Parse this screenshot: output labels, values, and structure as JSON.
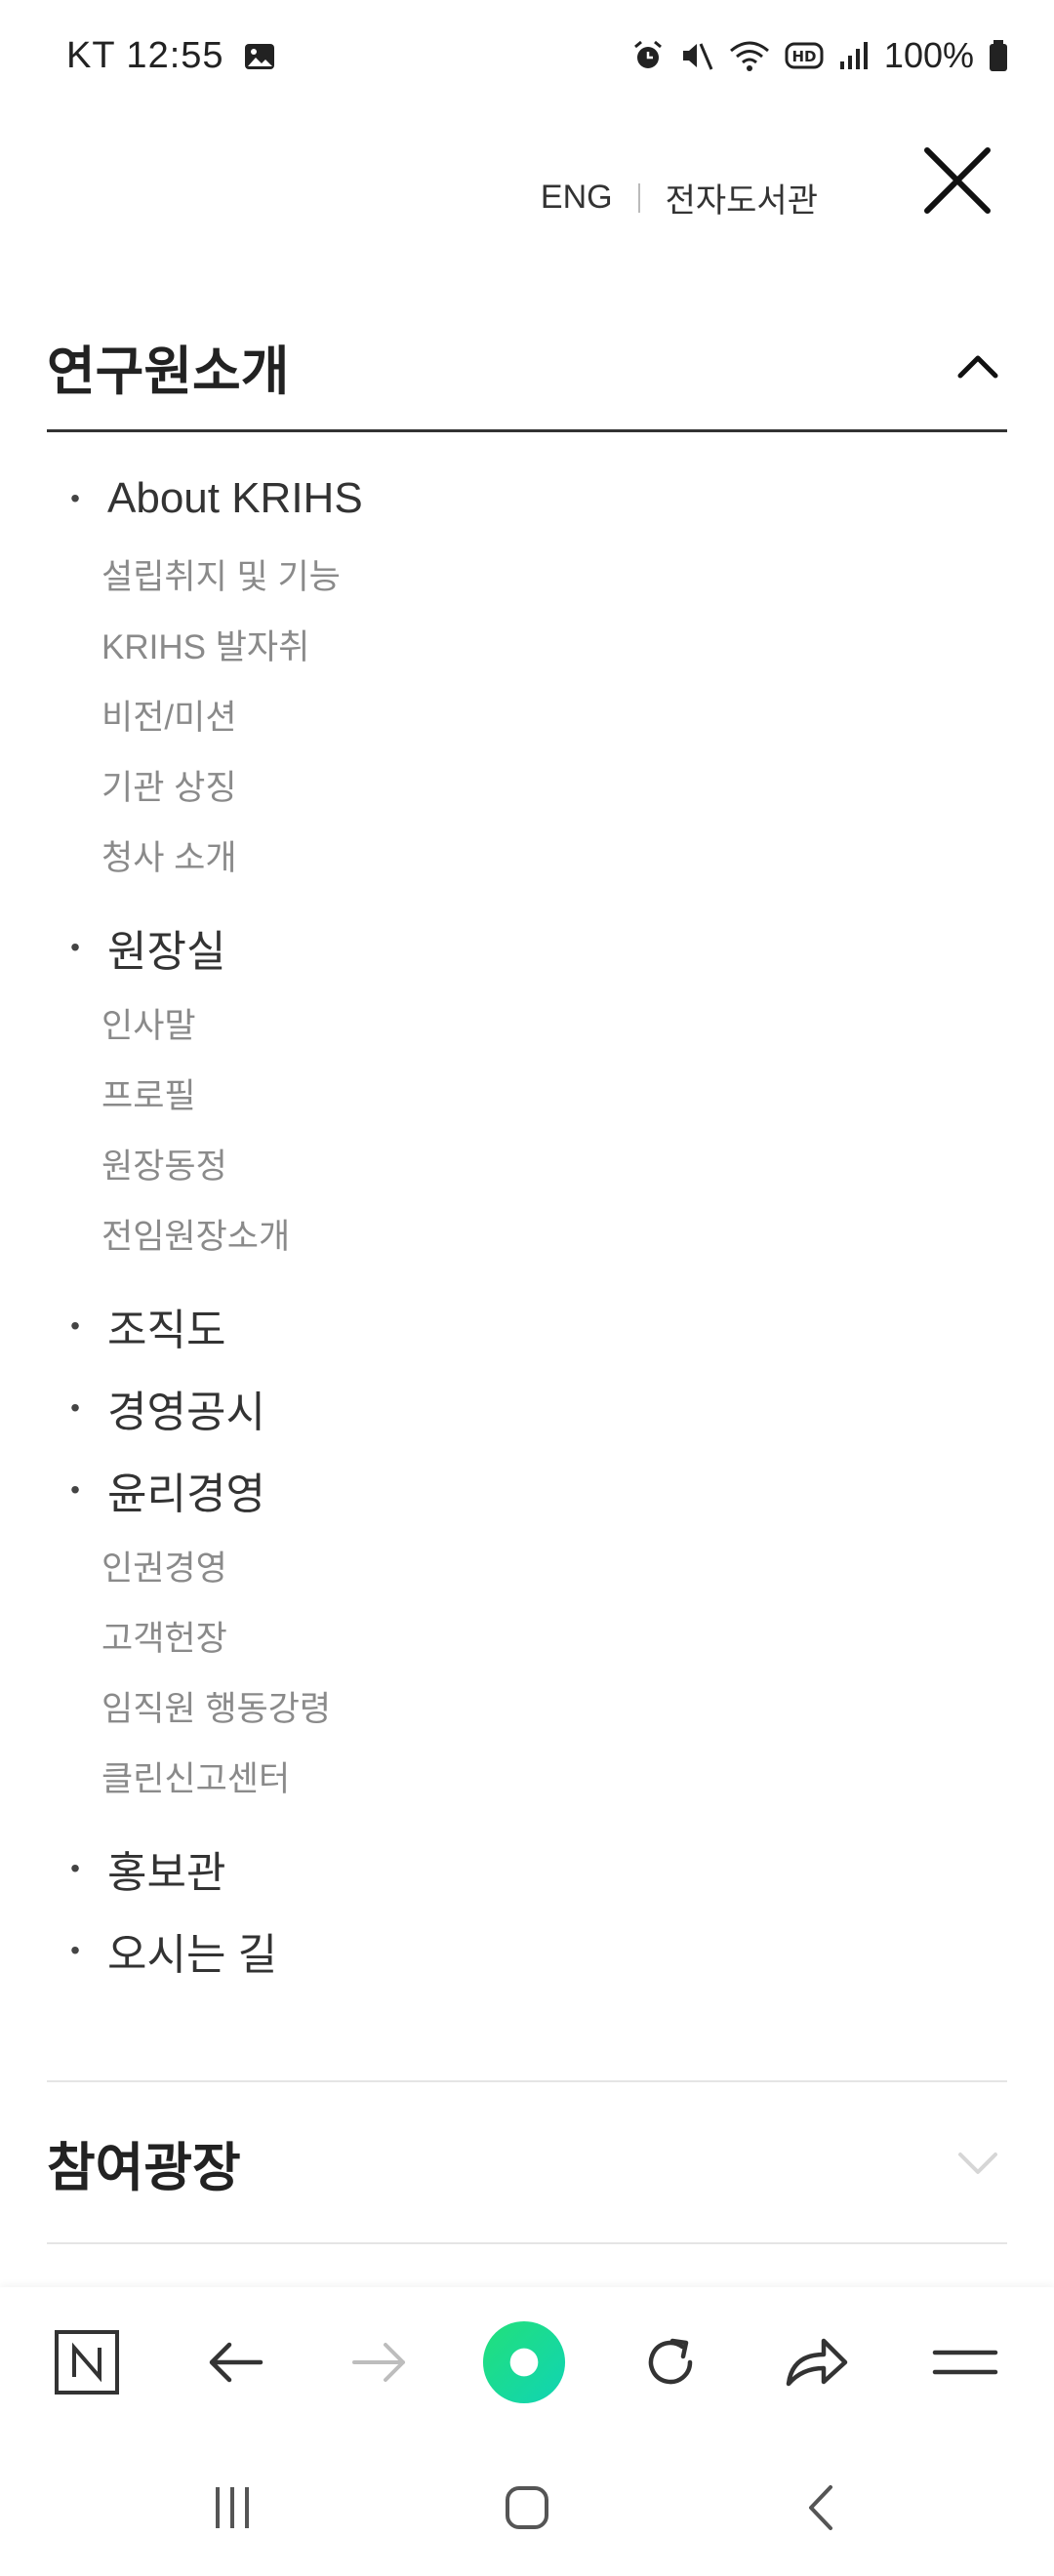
{
  "status_bar": {
    "carrier_time": "KT 12:55",
    "battery": "100%"
  },
  "header": {
    "eng_link": "ENG",
    "library_link": "전자도서관"
  },
  "sections": [
    {
      "title": "연구원소개",
      "expanded": true
    },
    {
      "title": "참여광장",
      "expanded": false
    }
  ],
  "menu": [
    {
      "label": "About KRIHS",
      "subs": [
        "설립취지 및 기능",
        "KRIHS 발자취",
        "비전/미션",
        "기관 상징",
        "청사 소개"
      ]
    },
    {
      "label": "원장실",
      "subs": [
        "인사말",
        "프로필",
        "원장동정",
        "전임원장소개"
      ]
    },
    {
      "label": "조직도",
      "subs": []
    },
    {
      "label": "경영공시",
      "subs": []
    },
    {
      "label": "윤리경영",
      "subs": [
        "인권경영",
        "고객헌장",
        "임직원 행동강령",
        "클린신고센터"
      ]
    },
    {
      "label": "홍보관",
      "subs": []
    },
    {
      "label": "오시는 길",
      "subs": []
    }
  ],
  "colors": {
    "accent_green": "#1fdc7a",
    "text_dark": "#222222",
    "text_sub": "#8a8a8a"
  },
  "toolbar_icons": [
    "naver-n-icon",
    "back-arrow-icon",
    "forward-arrow-icon",
    "green-dot-icon",
    "refresh-icon",
    "share-icon",
    "menu-icon"
  ],
  "nav_icons": [
    "recent-apps-icon",
    "home-icon",
    "back-icon"
  ]
}
